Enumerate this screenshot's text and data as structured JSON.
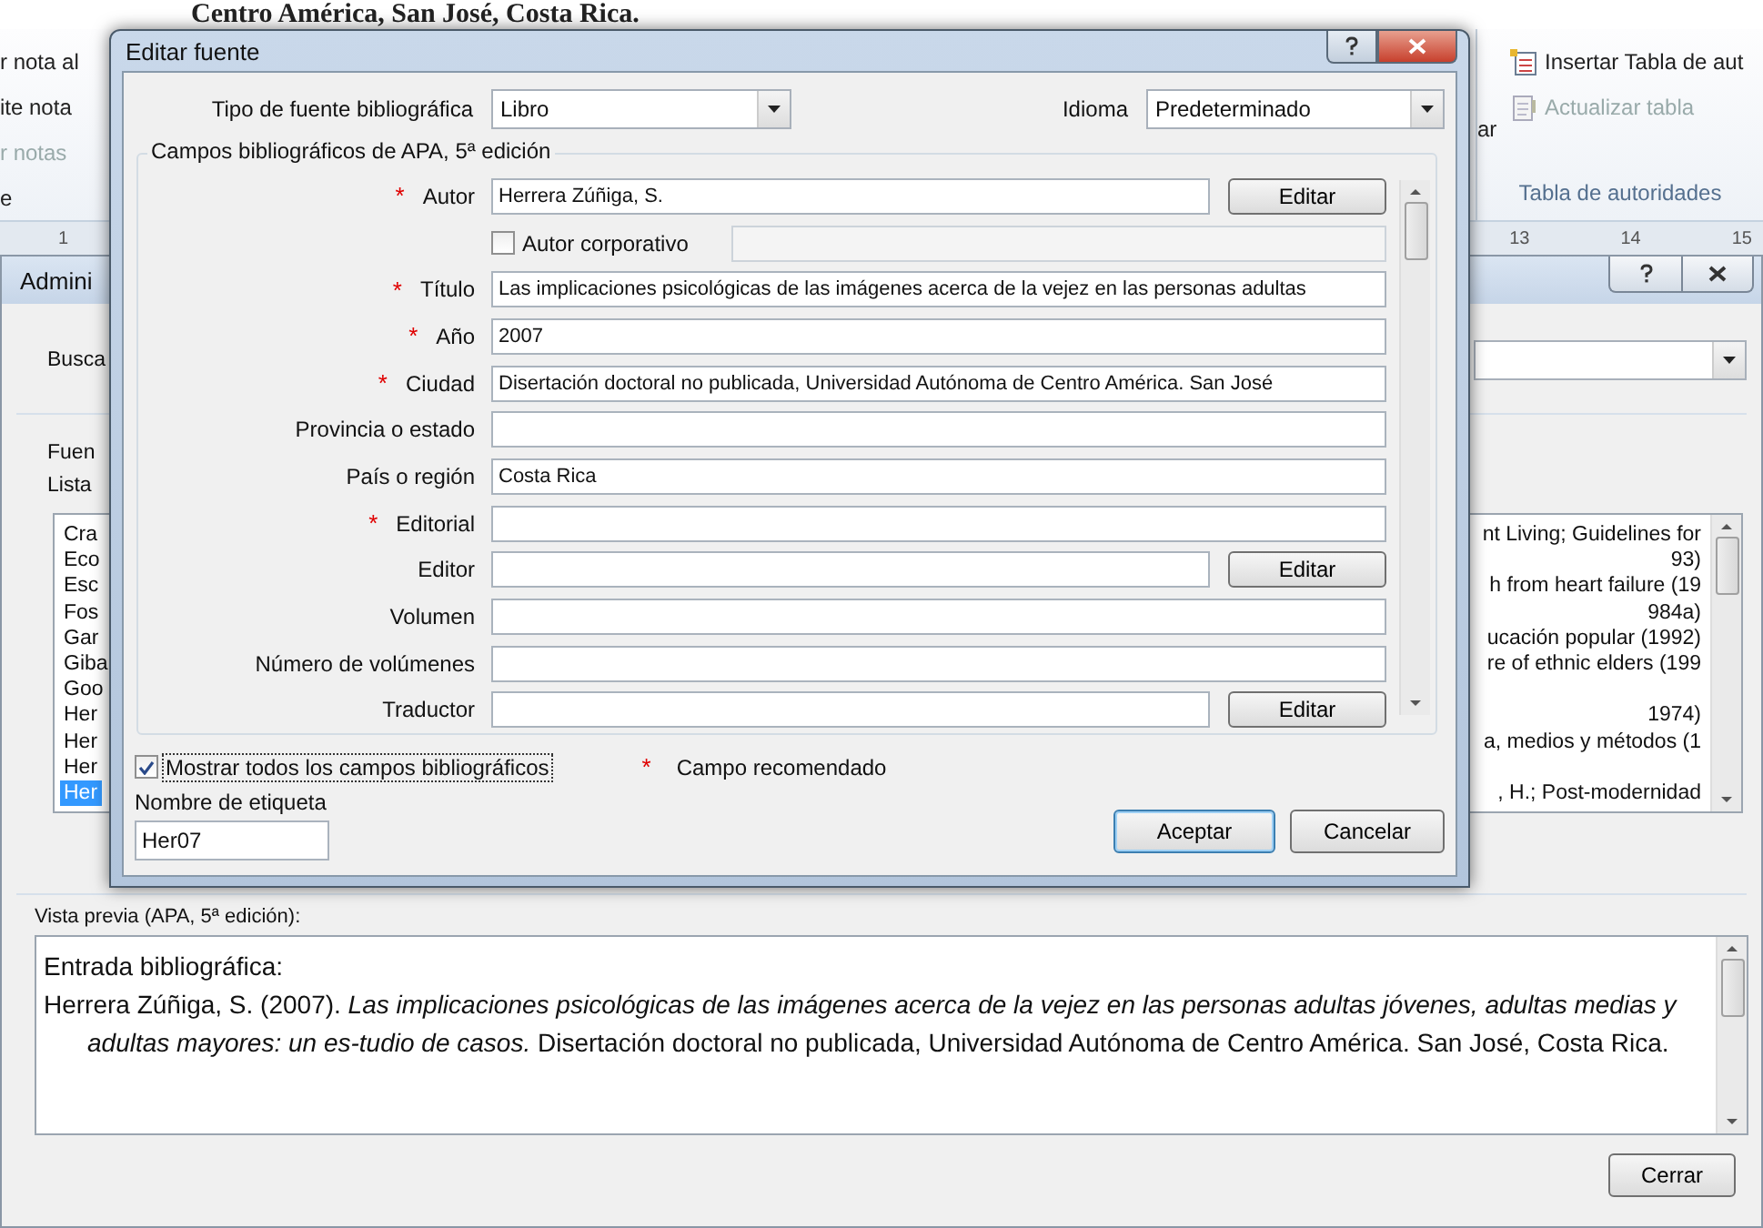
{
  "document": {
    "heading": "Centro América, San José, Costa Rica."
  },
  "ribbon": {
    "left_items": [
      {
        "label": "r nota al",
        "disabled": false
      },
      {
        "label": "ite nota",
        "disabled": false
      },
      {
        "label": "r notas",
        "disabled": true
      },
      {
        "label": "e",
        "disabled": false
      }
    ],
    "fragment": "ar",
    "commands": [
      {
        "label": "Insertar Tabla de aut",
        "disabled": false
      },
      {
        "label": "Actualizar tabla",
        "disabled": true
      }
    ],
    "group_label": "Tabla de autoridades"
  },
  "ruler": {
    "left_labels": [
      "1"
    ],
    "right_labels": [
      "13",
      "14",
      "15"
    ]
  },
  "manager_dialog": {
    "title": "Admini",
    "search_label": "Busca",
    "sources_label": "Fuen",
    "list_label": "Lista",
    "sources": [
      {
        "start": "Cra",
        "end": "nt Living; Guidelines for",
        "selected": false
      },
      {
        "start": "Eco",
        "end": "93)",
        "selected": false
      },
      {
        "start": "Esc",
        "end": "h from heart failure (19",
        "selected": false
      },
      {
        "start": "Fos",
        "end": "984a)",
        "selected": false
      },
      {
        "start": "Gar",
        "end": "ucación popular (1992)",
        "selected": false
      },
      {
        "start": "Giba",
        "end": "re of ethnic elders (199",
        "selected": false
      },
      {
        "start": "Goo",
        "selected": false
      },
      {
        "start": "Her",
        "end": "1974)",
        "selected": false
      },
      {
        "start": "Her",
        "end": "a, medios y métodos (1",
        "selected": false
      },
      {
        "start": "Her",
        "selected": false
      },
      {
        "start": "Her",
        "end": ", H.; Post-modernidad",
        "selected": true
      }
    ],
    "preview_label": "Vista previa (APA, 5ª edición):",
    "preview": {
      "heading": "Entrada bibliográfica:",
      "entry": "Herrera Zúñiga, S. (2007). *Las implicaciones psicológicas de las imágenes acerca de la vejez en las personas adultas jóvenes, adultas medias y adultas mayores: un es-tudio de casos.* Disertación doctoral no publicada, Universidad Autónoma de Centro América. San José, Costa Rica."
    },
    "close_button": "Cerrar"
  },
  "edit_dialog": {
    "title": "Editar fuente",
    "source_type": {
      "label": "Tipo de fuente bibliográfica",
      "value": "Libro"
    },
    "language": {
      "label": "Idioma",
      "value": "Predeterminado"
    },
    "group_title": "Campos bibliográficos de APA, 5ª edición",
    "required_mark": "*",
    "fields": [
      {
        "kind": "text",
        "label": "Autor",
        "required": true,
        "value": "Herrera Zúñiga, S.",
        "button": "Editar"
      },
      {
        "kind": "checkbox",
        "label": "Autor corporativo",
        "checked": false
      },
      {
        "kind": "text",
        "label": "Título",
        "required": true,
        "value": "Las implicaciones psicológicas de las imágenes acerca de la vejez en las personas adultas"
      },
      {
        "kind": "text",
        "label": "Año",
        "required": true,
        "value": "2007"
      },
      {
        "kind": "text",
        "label": "Ciudad",
        "required": true,
        "value": "Disertación doctoral no publicada, Universidad Autónoma de Centro América. San José"
      },
      {
        "kind": "text",
        "label": "Provincia o estado",
        "required": false
      },
      {
        "kind": "text",
        "label": "País o región",
        "required": false,
        "value": "Costa Rica"
      },
      {
        "kind": "text",
        "label": "Editorial",
        "required": true
      },
      {
        "kind": "text",
        "label": "Editor",
        "required": false,
        "button": "Editar"
      },
      {
        "kind": "text",
        "label": "Volumen",
        "required": false
      },
      {
        "kind": "text",
        "label": "Número de volúmenes",
        "required": false
      },
      {
        "kind": "text",
        "label": "Traductor",
        "required": false,
        "button": "Editar"
      }
    ],
    "show_all": {
      "label": "Mostrar todos los campos bibliográficos",
      "checked": true
    },
    "legend": "Campo recomendado",
    "tag_name": {
      "label": "Nombre de etiqueta",
      "value": "Her07"
    },
    "buttons": [
      {
        "label": "Aceptar",
        "default": true
      },
      {
        "label": "Cancelar",
        "default": false
      }
    ]
  }
}
